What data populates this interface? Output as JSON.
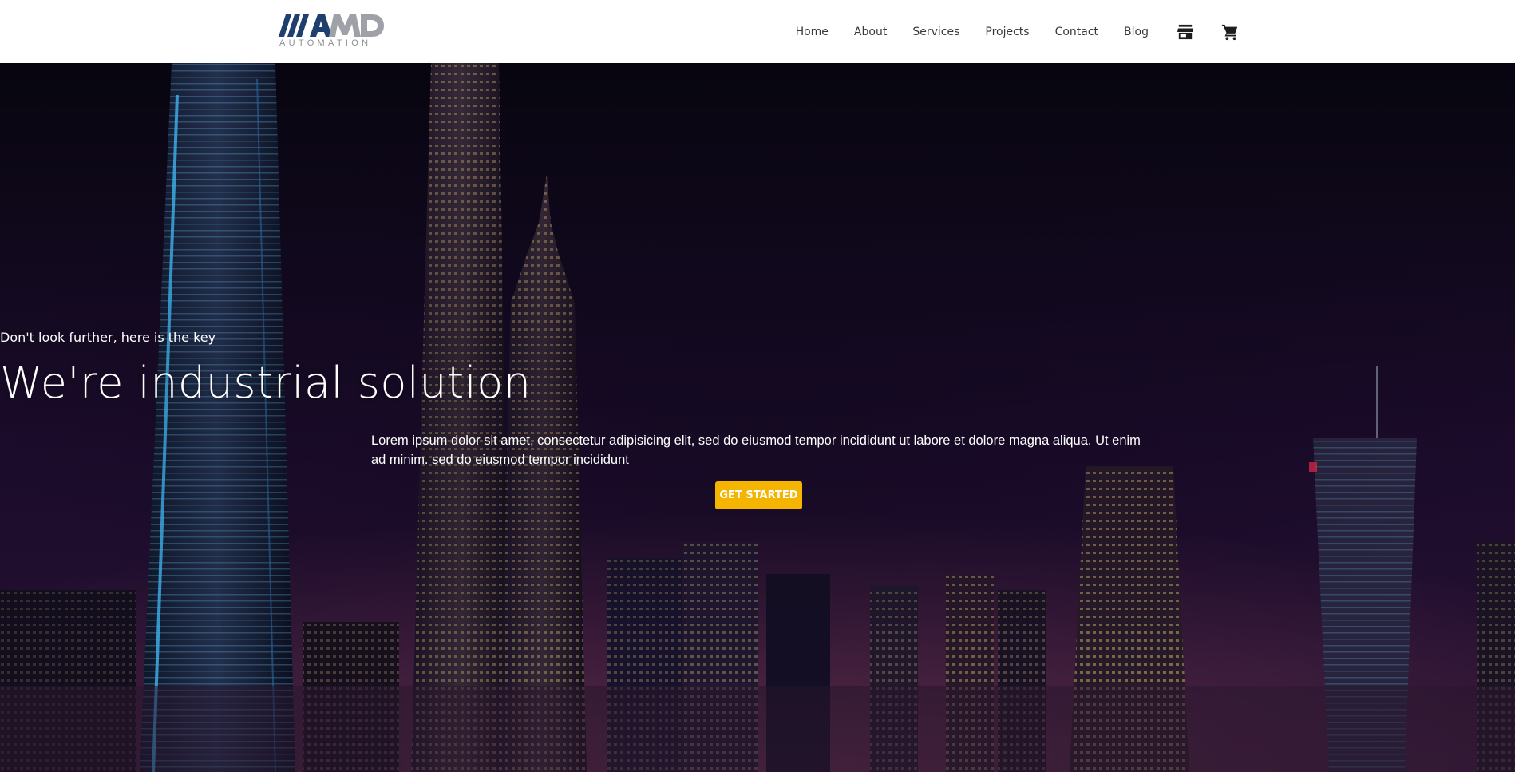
{
  "brand": {
    "logo_text": "AMD",
    "logo_subtitle": "AUTOMATION",
    "colors": {
      "primary": "#1f3f6e",
      "secondary": "#9ea2a8"
    }
  },
  "nav": {
    "items": [
      {
        "label": "Home"
      },
      {
        "label": "About"
      },
      {
        "label": "Services"
      },
      {
        "label": "Projects"
      },
      {
        "label": "Contact"
      },
      {
        "label": "Blog"
      }
    ],
    "icons": [
      {
        "icon": "store-icon"
      },
      {
        "icon": "shopping-cart-icon"
      }
    ]
  },
  "hero": {
    "tagline": "Don't look further, here is the key",
    "headline": "We're industrial solution",
    "description": "Lorem ipsum dolor sit amet, consectetur adipisicing elit, sed do eiusmod tempor incididunt ut labore et dolore magna aliqua. Ut enim ad minim. sed do eiusmod tempor incididunt",
    "cta_label": "Get Started",
    "cta_color": "#f5b400",
    "background": "night city skyline"
  }
}
